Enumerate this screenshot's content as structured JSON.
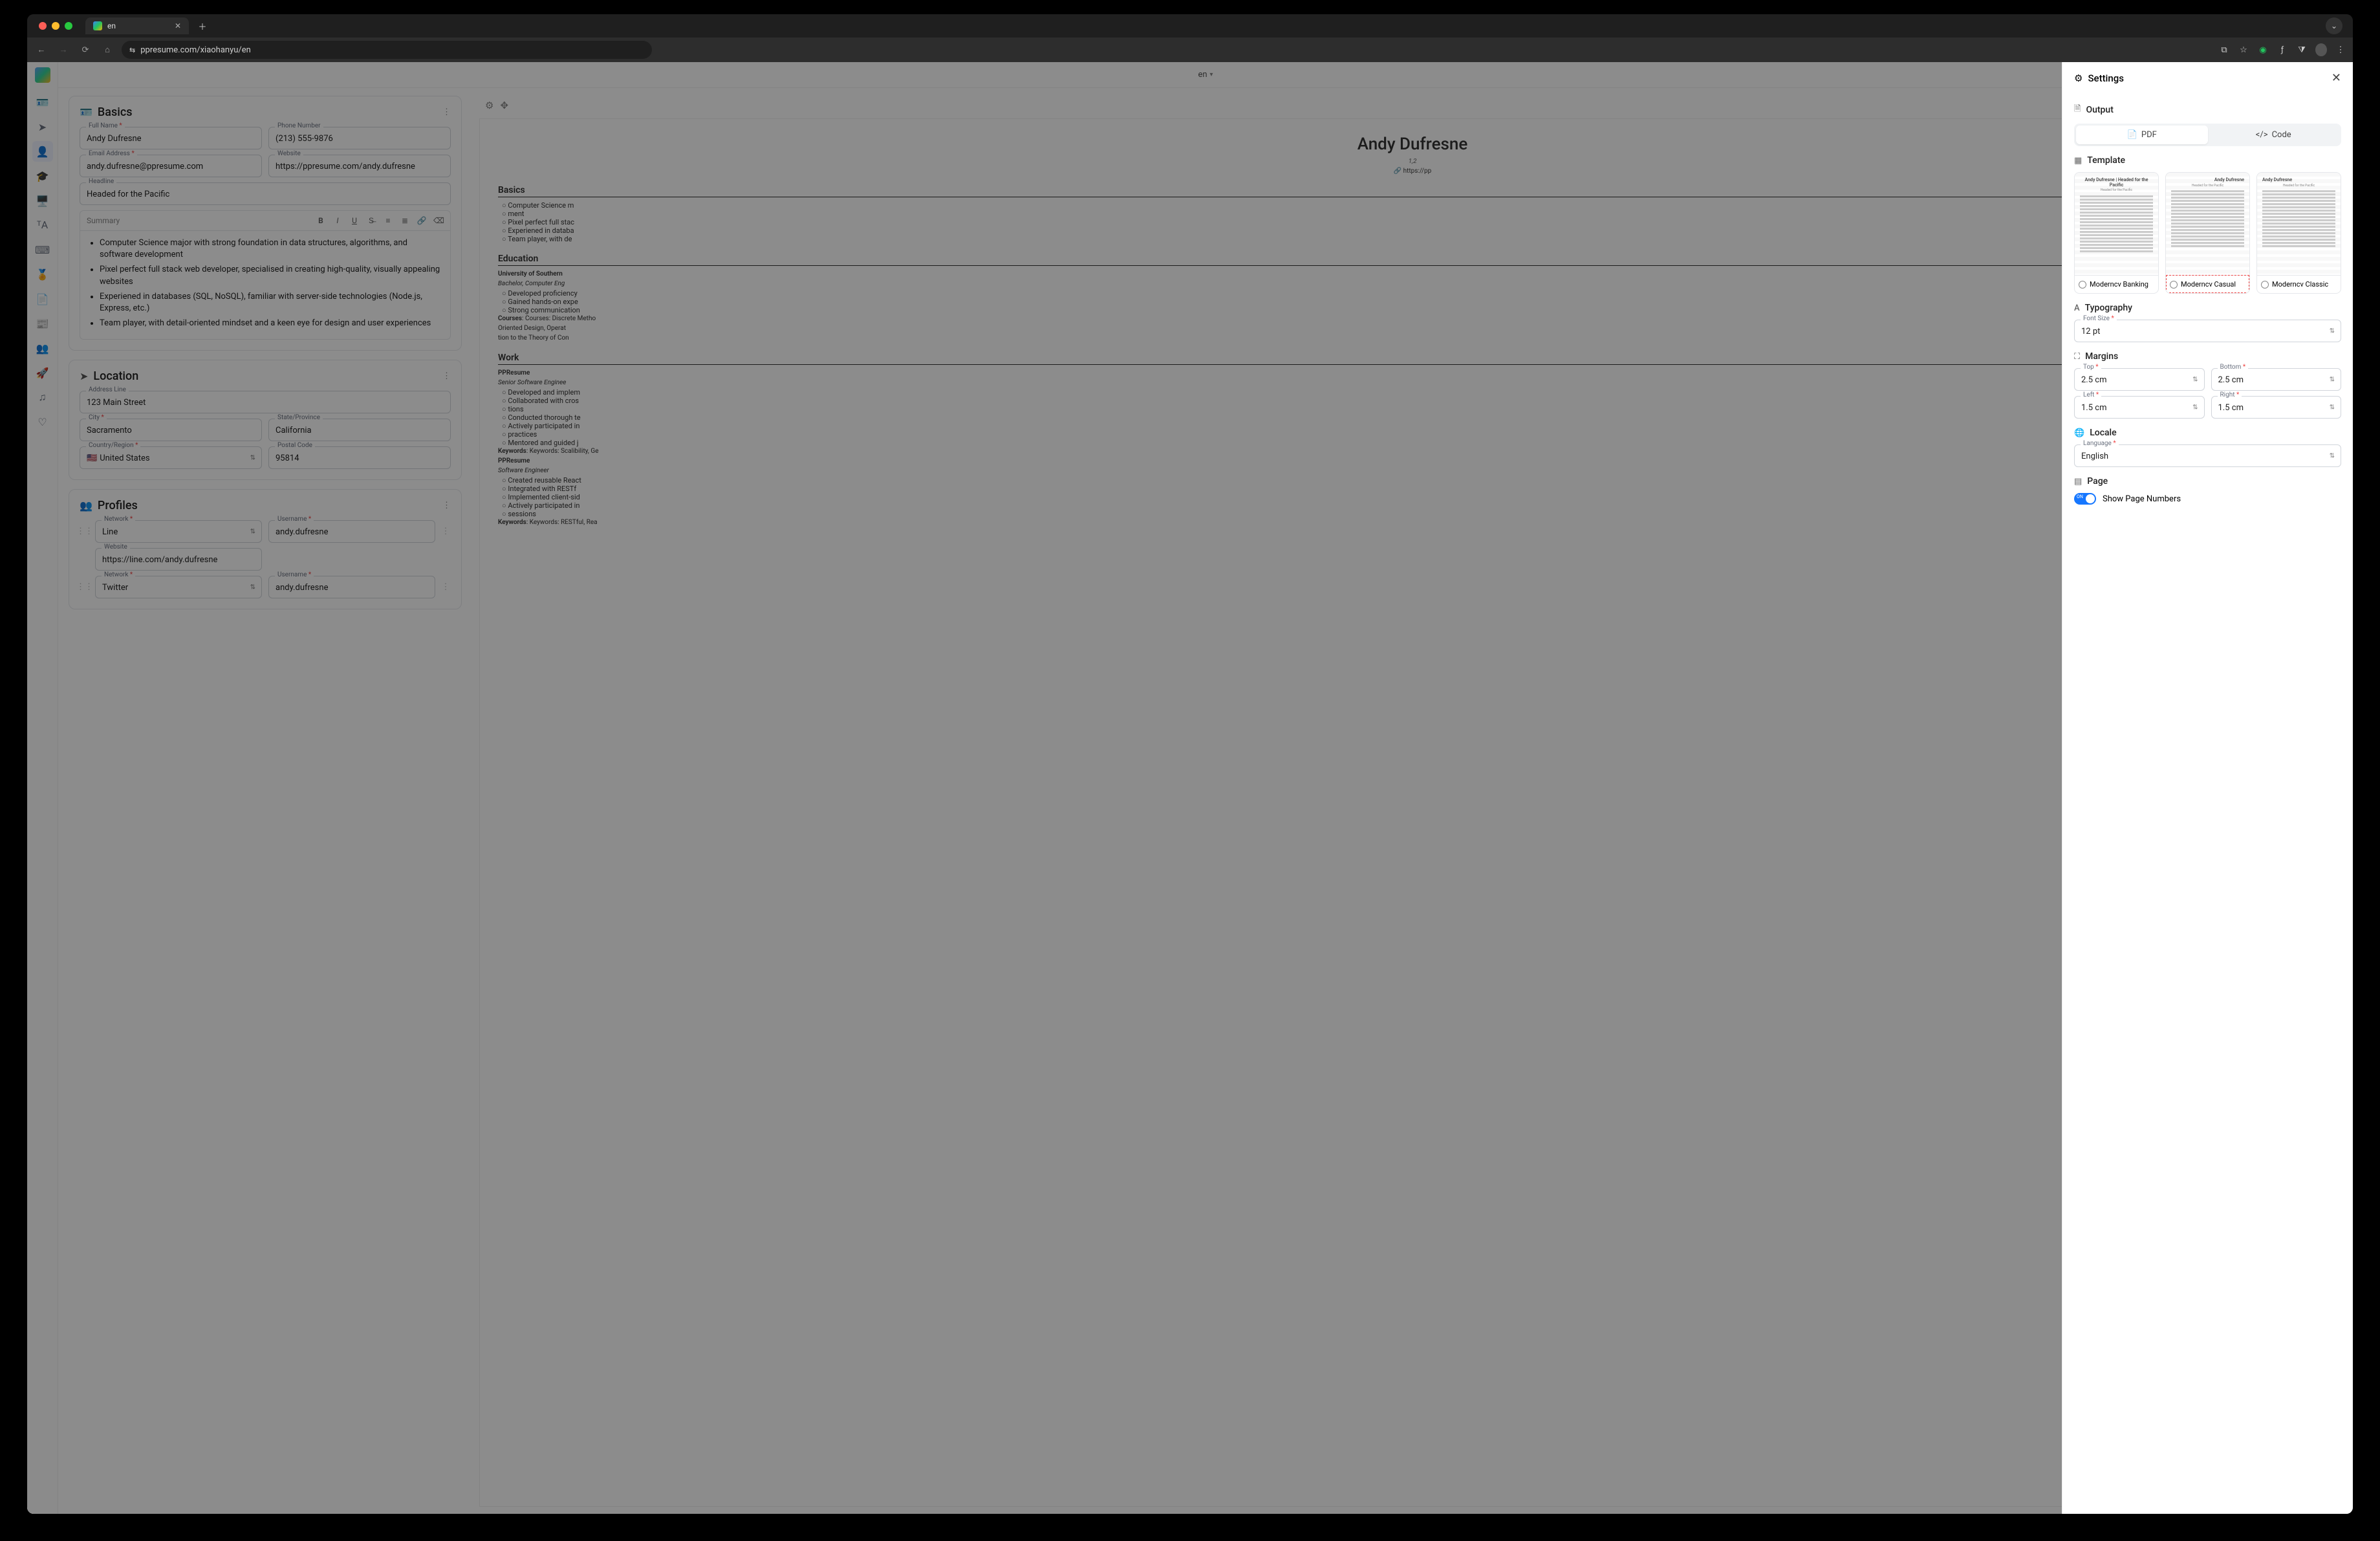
{
  "browser": {
    "tab_title": "en",
    "url": "ppresume.com/xiaohanyu/en"
  },
  "topbar": {
    "locale_label": "en"
  },
  "basics": {
    "section_title": "Basics",
    "full_name_label": "Full Name",
    "full_name": "Andy Dufresne",
    "phone_label": "Phone Number",
    "phone": "(213) 555-9876",
    "email_label": "Email Address",
    "email": "andy.dufresne@ppresume.com",
    "website_label": "Website",
    "website": "https://ppresume.com/andy.dufresne",
    "headline_label": "Headline",
    "headline": "Headed for the Pacific",
    "summary_label": "Summary",
    "summary_items": [
      "Computer Science major with strong foundation in data structures, algorithms, and software development",
      "Pixel perfect full stack web developer, specialised in creating high-quality, visually appealing websites",
      "Experiened in databases (SQL, NoSQL), familiar with server-side technologies (Node.js, Express, etc.)",
      "Team player, with detail-oriented mindset and a keen eye for design and user experiences"
    ]
  },
  "location": {
    "section_title": "Location",
    "address_label": "Address Line",
    "address": "123 Main Street",
    "city_label": "City",
    "city": "Sacramento",
    "state_label": "State/Province",
    "state": "California",
    "country_label": "Country/Region",
    "country": "United States",
    "flag": "🇺🇸",
    "postal_label": "Postal Code",
    "postal": "95814"
  },
  "profiles": {
    "section_title": "Profiles",
    "network_label": "Network",
    "username_label": "Username",
    "website_label": "Website",
    "items": [
      {
        "network": "Line",
        "username": "andy.dufresne",
        "website": "https://line.com/andy.dufresne"
      },
      {
        "network": "Twitter",
        "username": "andy.dufresne"
      }
    ]
  },
  "preview": {
    "name": "Andy Dufresne",
    "sublines": [
      "1,2",
      "🔗 https://pp"
    ],
    "sections": {
      "basics_title": "Basics",
      "basics_items": [
        "Computer Science m",
        "ment",
        "Pixel perfect full stac",
        "Experiened in databa",
        "Team player, with de"
      ],
      "education_title": "Education",
      "education_org": "University of Southern",
      "education_degree": "Bachelor, Computer Eng",
      "education_items": [
        "Developed proficiency",
        "Gained hands-on expe",
        "Strong communication"
      ],
      "education_courses": "Courses: Discrete Metho",
      "education_courses2": "Oriented Design, Operat",
      "education_courses3": "tion to the Theory of Con",
      "work_title": "Work",
      "work_org": "PPResume",
      "work_role": "Senior Software Enginee",
      "work_items": [
        "Developed and implem",
        "Collaborated with cros",
        "tions",
        "Conducted thorough te",
        "Actively participated in",
        "practices",
        "Mentored and guided j"
      ],
      "work_kw": "Keywords: Scalibility, Ge",
      "work_org2": "PPResume",
      "work_role2": "Software Engineer",
      "work_items2": [
        "Created reusable React",
        "Integrated with RESTf",
        "Implemented client-sid",
        "Actively participated in",
        "sessions"
      ],
      "work_kw2": "Keywords: RESTful, Rea"
    }
  },
  "settings": {
    "title": "Settings",
    "output": {
      "title": "Output",
      "pdf": "PDF",
      "code": "Code"
    },
    "template": {
      "title": "Template",
      "options": [
        {
          "label": "Moderncv Banking",
          "thumb_name": "Andy Dufresne | Headed for the Pacific"
        },
        {
          "label": "Moderncv Casual",
          "thumb_name": "Andy Dufresne"
        },
        {
          "label": "Moderncv Classic",
          "thumb_name": "Andy Dufresne"
        }
      ],
      "selected_index": 1
    },
    "typography": {
      "title": "Typography",
      "font_size_label": "Font Size",
      "font_size": "12 pt"
    },
    "margins": {
      "title": "Margins",
      "top_label": "Top",
      "top": "2.5 cm",
      "bottom_label": "Bottom",
      "bottom": "2.5 cm",
      "left_label": "Left",
      "left": "1.5 cm",
      "right_label": "Right",
      "right": "1.5 cm"
    },
    "locale": {
      "title": "Locale",
      "language_label": "Language",
      "language": "English"
    },
    "page": {
      "title": "Page",
      "show_numbers_label": "Show Page Numbers",
      "show_numbers": true
    }
  }
}
